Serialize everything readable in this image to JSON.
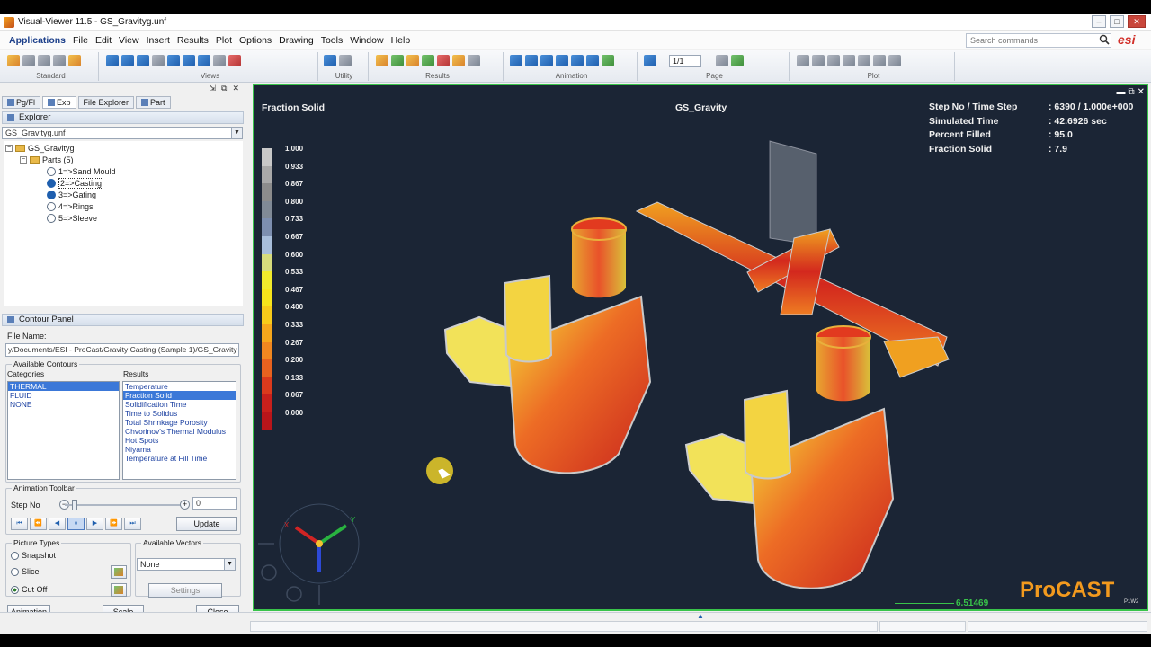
{
  "window": {
    "title": "Visual-Viewer 11.5 - GS_Gravityg.unf",
    "buttons": [
      "–",
      "□",
      "✕"
    ]
  },
  "menu": [
    "Applications",
    "File",
    "Edit",
    "View",
    "Insert",
    "Results",
    "Plot",
    "Options",
    "Drawing",
    "Tools",
    "Window",
    "Help"
  ],
  "search": {
    "placeholder": "Search commands"
  },
  "brand_logo": "esi",
  "toolbar": {
    "groups": [
      "Standard",
      "Views",
      "Utility",
      "Results",
      "Animation",
      "Page",
      "Plot"
    ],
    "page_value": "1/1"
  },
  "left_panel": {
    "tabs": [
      "Pg/Fl",
      "Exp",
      "File Explorer",
      "Part"
    ],
    "explorer_title": "Explorer",
    "file_combo": "GS_Gravityg.unf",
    "tree": {
      "root": "GS_Gravityg",
      "parts_label": "Parts (5)",
      "parts": [
        {
          "label": "1=>Sand Mould",
          "checked": false
        },
        {
          "label": "2=>Casting",
          "checked": true,
          "selected": true
        },
        {
          "label": "3=>Gating",
          "checked": true
        },
        {
          "label": "4=>Rings",
          "checked": false
        },
        {
          "label": "5=>Sleeve",
          "checked": false
        }
      ]
    },
    "contour_panel": {
      "title": "Contour Panel",
      "file_name_label": "File Name:",
      "file_name": "y/Documents/ESI - ProCast/Gravity Casting (Sample 1)/GS_Gravity",
      "available_contours_label": "Available Contours",
      "categories_label": "Categories",
      "results_label": "Results",
      "categories": [
        "THERMAL",
        "FLUID",
        "NONE"
      ],
      "selected_category": "THERMAL",
      "results": [
        "Temperature",
        "Fraction Solid",
        "Solidification Time",
        "Time to Solidus",
        "Total Shrinkage Porosity",
        "Chvorinov's Thermal Modulus",
        "Hot Spots",
        "Niyama",
        "Temperature at Fill Time"
      ],
      "selected_result": "Fraction Solid"
    },
    "animation_toolbar": {
      "title": "Animation Toolbar",
      "step_label": "Step No",
      "step_value": "0",
      "update_label": "Update",
      "buttons": [
        "⏮",
        "⏪",
        "◀",
        "⏸",
        "▶",
        "⏩",
        "⏭"
      ]
    },
    "picture_types": {
      "title": "Picture Types",
      "options": [
        "Snapshot",
        "Slice",
        "Cut Off"
      ],
      "selected": "Cut Off"
    },
    "available_vectors": {
      "title": "Available Vectors",
      "value": "None",
      "settings_label": "Settings"
    },
    "bottom_buttons": [
      "Animation",
      "Scale",
      "Close"
    ]
  },
  "viewport": {
    "result_name": "Fraction Solid",
    "model_name": "GS_Gravity",
    "info": [
      {
        "key": "Step No / Time Step",
        "value": ": 6390 / 1.000e+000"
      },
      {
        "key": "Simulated Time",
        "value": ": 42.6926 sec"
      },
      {
        "key": "Percent Filled",
        "value": ": 95.0"
      },
      {
        "key": "Fraction Solid",
        "value": ": 7.9"
      }
    ],
    "legend_values": [
      "1.000",
      "0.933",
      "0.867",
      "0.800",
      "0.733",
      "0.667",
      "0.600",
      "0.533",
      "0.467",
      "0.400",
      "0.333",
      "0.267",
      "0.200",
      "0.133",
      "0.067",
      "0.000"
    ],
    "legend_colors": [
      "#c8c8c8",
      "#a9a9a9",
      "#8c8c8c",
      "#808a96",
      "#7d8fb0",
      "#a8bedb",
      "#d7dc7c",
      "#f1ea2c",
      "#f7e51b",
      "#f8cb1a",
      "#f6a71c",
      "#f08720",
      "#e8621f",
      "#db3a1d",
      "#c8201c",
      "#b9151a"
    ],
    "scale_value": "6.51469",
    "logo": "ProCAST",
    "page_tag": "P1W2",
    "axes": {
      "x": "X",
      "y": "Y"
    }
  }
}
